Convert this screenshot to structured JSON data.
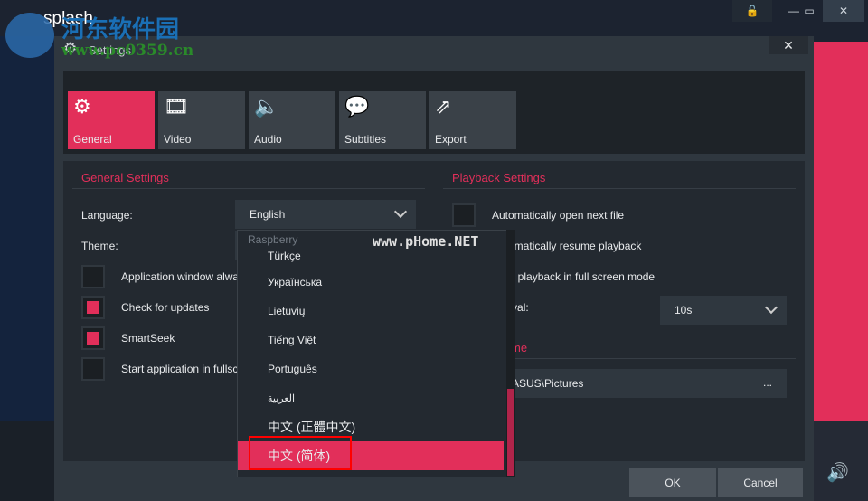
{
  "app": {
    "title": "splash",
    "lock_color": "#1a8a5a"
  },
  "dialog": {
    "title": "Settings",
    "close": "✕"
  },
  "tabs": [
    {
      "label": "General",
      "icon": "gear-icon",
      "glyph": "⚙",
      "active": true
    },
    {
      "label": "Video",
      "icon": "film-icon",
      "glyph": "🎞"
    },
    {
      "label": "Audio",
      "icon": "speaker-icon",
      "glyph": "🔈"
    },
    {
      "label": "Subtitles",
      "icon": "speech-bubble-icon",
      "glyph": "💬"
    },
    {
      "label": "Export",
      "icon": "export-icon",
      "glyph": "⇗"
    }
  ],
  "general": {
    "heading": "General Settings",
    "language_label": "Language:",
    "language_value": "English",
    "theme_label": "Theme:",
    "theme_value": "Raspberry",
    "checks": [
      {
        "label": "Application window always on top",
        "checked": false
      },
      {
        "label": "Check for updates",
        "checked": true
      },
      {
        "label": "SmartSeek",
        "checked": true
      },
      {
        "label": "Start application in fullscreen mode",
        "checked": false
      }
    ]
  },
  "playback": {
    "heading": "Playback Settings",
    "checks": [
      {
        "label": "Automatically open next file",
        "checked": false
      },
      {
        "label": "Automatically resume playback",
        "checked": false
      },
      {
        "label": "Start playback in full screen mode",
        "checked": false
      }
    ],
    "jump_label": "Jump interval:",
    "jump_value": "10s",
    "capture_heading": "Capture frame",
    "capture_path": "C:\\Users\\ASUS\\Pictures",
    "browse": "..."
  },
  "language_options": [
    "Türkçe",
    "Українська",
    "Lietuvių",
    "Tiếng Việt",
    "Português",
    "العربية",
    "中文 (正體中文)",
    "中文 (简体)"
  ],
  "selected_option": "中文 (简体)",
  "buttons": {
    "ok": "OK",
    "cancel": "Cancel"
  },
  "watermarks": {
    "cn": "河东软件园",
    "url1": "www.pc0359.cn",
    "url2": "www.pHome.NET"
  },
  "colors": {
    "accent": "#e22f5a",
    "background": "#1c2330"
  }
}
